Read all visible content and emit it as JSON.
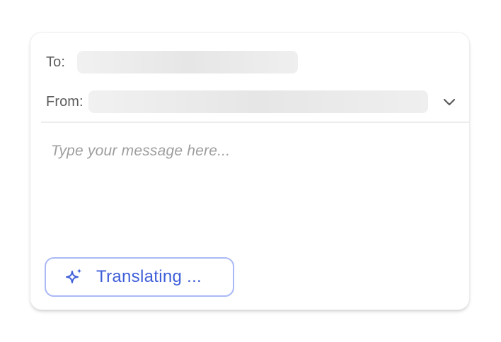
{
  "compose": {
    "to_label": "To:",
    "from_label": "From:",
    "message_placeholder": "Type your message here...",
    "translate_button_label": "Translating ...",
    "icons": {
      "dropdown": "chevron-down-icon",
      "translate": "sparkle-icon"
    }
  },
  "colors": {
    "accent": "#3f5fd8",
    "button_border": "#aab9f5",
    "label_text": "#5c5c5c",
    "placeholder_text": "#9e9e9e"
  }
}
